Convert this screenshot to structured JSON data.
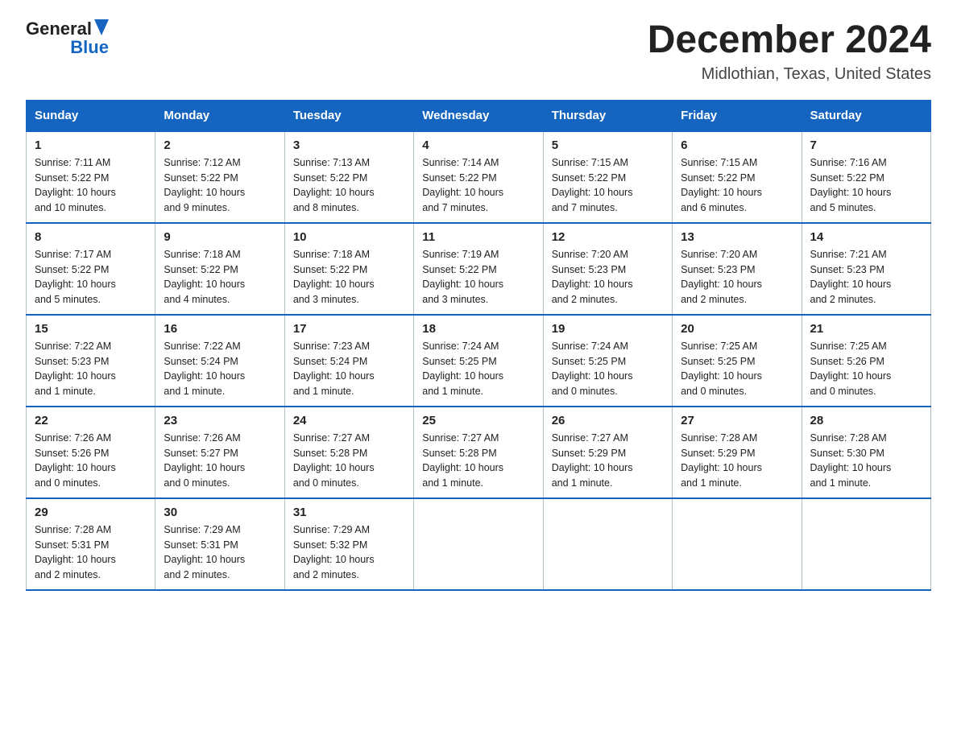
{
  "logo": {
    "text1": "General",
    "text2": "Blue"
  },
  "title": "December 2024",
  "location": "Midlothian, Texas, United States",
  "weekdays": [
    "Sunday",
    "Monday",
    "Tuesday",
    "Wednesday",
    "Thursday",
    "Friday",
    "Saturday"
  ],
  "weeks": [
    [
      {
        "day": "1",
        "sunrise": "7:11 AM",
        "sunset": "5:22 PM",
        "daylight": "10 hours and 10 minutes."
      },
      {
        "day": "2",
        "sunrise": "7:12 AM",
        "sunset": "5:22 PM",
        "daylight": "10 hours and 9 minutes."
      },
      {
        "day": "3",
        "sunrise": "7:13 AM",
        "sunset": "5:22 PM",
        "daylight": "10 hours and 8 minutes."
      },
      {
        "day": "4",
        "sunrise": "7:14 AM",
        "sunset": "5:22 PM",
        "daylight": "10 hours and 7 minutes."
      },
      {
        "day": "5",
        "sunrise": "7:15 AM",
        "sunset": "5:22 PM",
        "daylight": "10 hours and 7 minutes."
      },
      {
        "day": "6",
        "sunrise": "7:15 AM",
        "sunset": "5:22 PM",
        "daylight": "10 hours and 6 minutes."
      },
      {
        "day": "7",
        "sunrise": "7:16 AM",
        "sunset": "5:22 PM",
        "daylight": "10 hours and 5 minutes."
      }
    ],
    [
      {
        "day": "8",
        "sunrise": "7:17 AM",
        "sunset": "5:22 PM",
        "daylight": "10 hours and 5 minutes."
      },
      {
        "day": "9",
        "sunrise": "7:18 AM",
        "sunset": "5:22 PM",
        "daylight": "10 hours and 4 minutes."
      },
      {
        "day": "10",
        "sunrise": "7:18 AM",
        "sunset": "5:22 PM",
        "daylight": "10 hours and 3 minutes."
      },
      {
        "day": "11",
        "sunrise": "7:19 AM",
        "sunset": "5:22 PM",
        "daylight": "10 hours and 3 minutes."
      },
      {
        "day": "12",
        "sunrise": "7:20 AM",
        "sunset": "5:23 PM",
        "daylight": "10 hours and 2 minutes."
      },
      {
        "day": "13",
        "sunrise": "7:20 AM",
        "sunset": "5:23 PM",
        "daylight": "10 hours and 2 minutes."
      },
      {
        "day": "14",
        "sunrise": "7:21 AM",
        "sunset": "5:23 PM",
        "daylight": "10 hours and 2 minutes."
      }
    ],
    [
      {
        "day": "15",
        "sunrise": "7:22 AM",
        "sunset": "5:23 PM",
        "daylight": "10 hours and 1 minute."
      },
      {
        "day": "16",
        "sunrise": "7:22 AM",
        "sunset": "5:24 PM",
        "daylight": "10 hours and 1 minute."
      },
      {
        "day": "17",
        "sunrise": "7:23 AM",
        "sunset": "5:24 PM",
        "daylight": "10 hours and 1 minute."
      },
      {
        "day": "18",
        "sunrise": "7:24 AM",
        "sunset": "5:25 PM",
        "daylight": "10 hours and 1 minute."
      },
      {
        "day": "19",
        "sunrise": "7:24 AM",
        "sunset": "5:25 PM",
        "daylight": "10 hours and 0 minutes."
      },
      {
        "day": "20",
        "sunrise": "7:25 AM",
        "sunset": "5:25 PM",
        "daylight": "10 hours and 0 minutes."
      },
      {
        "day": "21",
        "sunrise": "7:25 AM",
        "sunset": "5:26 PM",
        "daylight": "10 hours and 0 minutes."
      }
    ],
    [
      {
        "day": "22",
        "sunrise": "7:26 AM",
        "sunset": "5:26 PM",
        "daylight": "10 hours and 0 minutes."
      },
      {
        "day": "23",
        "sunrise": "7:26 AM",
        "sunset": "5:27 PM",
        "daylight": "10 hours and 0 minutes."
      },
      {
        "day": "24",
        "sunrise": "7:27 AM",
        "sunset": "5:28 PM",
        "daylight": "10 hours and 0 minutes."
      },
      {
        "day": "25",
        "sunrise": "7:27 AM",
        "sunset": "5:28 PM",
        "daylight": "10 hours and 1 minute."
      },
      {
        "day": "26",
        "sunrise": "7:27 AM",
        "sunset": "5:29 PM",
        "daylight": "10 hours and 1 minute."
      },
      {
        "day": "27",
        "sunrise": "7:28 AM",
        "sunset": "5:29 PM",
        "daylight": "10 hours and 1 minute."
      },
      {
        "day": "28",
        "sunrise": "7:28 AM",
        "sunset": "5:30 PM",
        "daylight": "10 hours and 1 minute."
      }
    ],
    [
      {
        "day": "29",
        "sunrise": "7:28 AM",
        "sunset": "5:31 PM",
        "daylight": "10 hours and 2 minutes."
      },
      {
        "day": "30",
        "sunrise": "7:29 AM",
        "sunset": "5:31 PM",
        "daylight": "10 hours and 2 minutes."
      },
      {
        "day": "31",
        "sunrise": "7:29 AM",
        "sunset": "5:32 PM",
        "daylight": "10 hours and 2 minutes."
      },
      null,
      null,
      null,
      null
    ]
  ],
  "labels": {
    "sunrise": "Sunrise:",
    "sunset": "Sunset:",
    "daylight": "Daylight:"
  }
}
